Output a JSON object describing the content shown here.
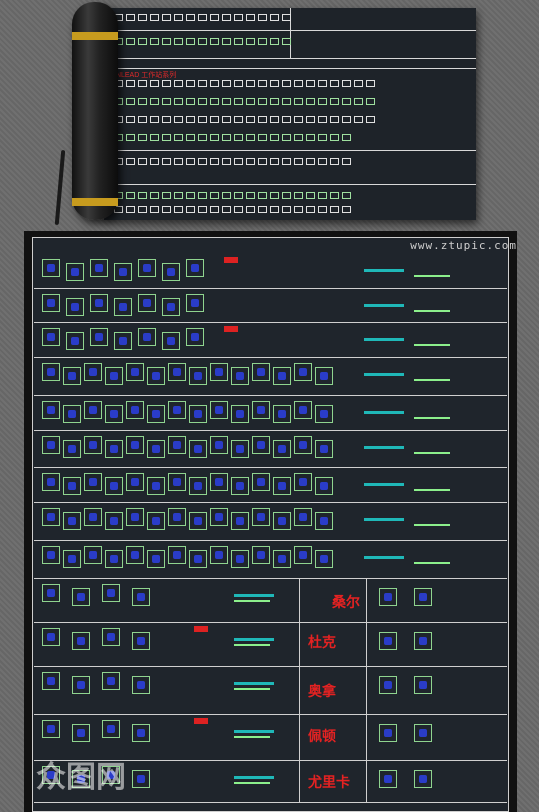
{
  "watermark": "www.ztupic.com",
  "sheet": {
    "heading": "INLEAD 工作站系列"
  },
  "series_labels": [
    "桑尔",
    "杜克",
    "奥拿",
    "佩顿",
    "尤里卡"
  ],
  "colors": {
    "background": "#6d6d6d",
    "panel": "#1f252c",
    "frame": "#d0d0d0",
    "desk_outline": "#8fd48f",
    "chair": "#2a3cc8",
    "cyan": "#1fb8b8",
    "label_red": "#e42222",
    "roll_band": "#c79b1e"
  },
  "logo": "众图网"
}
